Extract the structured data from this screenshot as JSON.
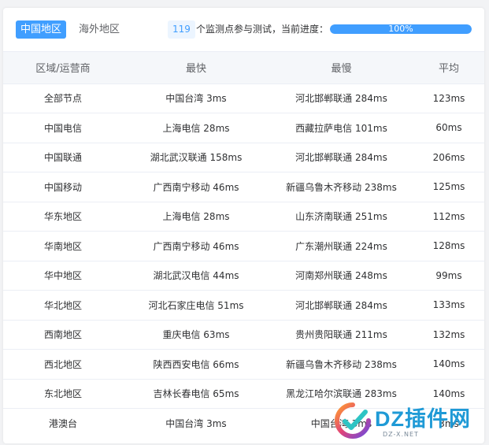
{
  "tabs": [
    {
      "label": "中国地区",
      "active": true
    },
    {
      "label": "海外地区",
      "active": false
    }
  ],
  "status": {
    "count": "119",
    "text": "个监测点参与测试，当前进度：",
    "progress_percent": 100,
    "progress_label": "100%"
  },
  "table": {
    "headers": [
      "区域/运营商",
      "最快",
      "最慢",
      "平均"
    ],
    "rows": [
      [
        "全部节点",
        "中国台湾 3ms",
        "河北邯郸联通 284ms",
        "123ms"
      ],
      [
        "中国电信",
        "上海电信 28ms",
        "西藏拉萨电信 101ms",
        "60ms"
      ],
      [
        "中国联通",
        "湖北武汉联通 158ms",
        "河北邯郸联通 284ms",
        "206ms"
      ],
      [
        "中国移动",
        "广西南宁移动 46ms",
        "新疆乌鲁木齐移动 238ms",
        "125ms"
      ],
      [
        "华东地区",
        "上海电信 28ms",
        "山东济南联通 251ms",
        "112ms"
      ],
      [
        "华南地区",
        "广西南宁移动 46ms",
        "广东潮州联通 224ms",
        "128ms"
      ],
      [
        "华中地区",
        "湖北武汉电信 44ms",
        "河南郑州联通 248ms",
        "99ms"
      ],
      [
        "华北地区",
        "河北石家庄电信 51ms",
        "河北邯郸联通 284ms",
        "133ms"
      ],
      [
        "西南地区",
        "重庆电信 63ms",
        "贵州贵阳联通 211ms",
        "132ms"
      ],
      [
        "西北地区",
        "陕西西安电信 66ms",
        "新疆乌鲁木齐移动 238ms",
        "140ms"
      ],
      [
        "东北地区",
        "吉林长春电信 65ms",
        "黑龙江哈尔滨联通 283ms",
        "140ms"
      ],
      [
        "港澳台",
        "中国台湾 3ms",
        "中国台湾 3ms",
        "3ms"
      ]
    ]
  },
  "watermark": {
    "text": "DZ插件网",
    "sub": "DZ-X.NET",
    "logo_icon": "dz-logo-icon"
  },
  "colors": {
    "accent": "#409eff",
    "header_bg": "#f5f7fa"
  }
}
